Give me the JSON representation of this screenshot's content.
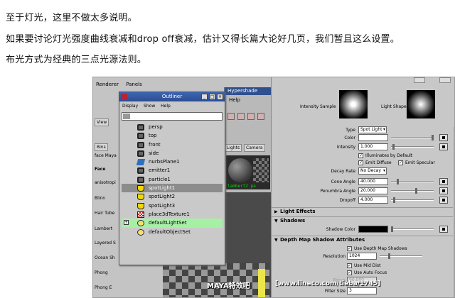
{
  "article": {
    "line1": "至于灯光，这里不做太多说明。",
    "line2": "如果要讨论灯光强度曲线衰减和drop off衰减，估计又得长篇大论好几页，我们暂且这么设置。",
    "line3": "布光方式为经典的三点光源法则。"
  },
  "maya": {
    "menu": [
      "Renderer",
      "Panels"
    ],
    "view_label": "View",
    "bins_label": "Bins",
    "maya_label": "face Maya",
    "left_list": [
      "Face",
      "anisotropi",
      "Blinn",
      "Hair Tube",
      "Lambert",
      "Layered S",
      "Ocean Sh",
      "Phong",
      "Phong E"
    ]
  },
  "hypershade": {
    "title": "Hypershade",
    "help": "Help",
    "tabs": [
      "Lights",
      "Camera"
    ],
    "lambert_label": "lambert2",
    "pa_label": "pa"
  },
  "outliner": {
    "title": "Outliner",
    "menu": [
      "Display",
      "Show",
      "Help"
    ],
    "items": [
      {
        "label": "persp",
        "icon": "camera-icon"
      },
      {
        "label": "top",
        "icon": "camera-icon"
      },
      {
        "label": "front",
        "icon": "camera-icon"
      },
      {
        "label": "side",
        "icon": "camera-icon"
      },
      {
        "label": "nurbsPlane1",
        "icon": "plane-icon"
      },
      {
        "label": "emitter1",
        "icon": "emitter-icon"
      },
      {
        "label": "particle1",
        "icon": "particle-icon"
      },
      {
        "label": "spotLight1",
        "icon": "light-icon",
        "selected": true
      },
      {
        "label": "spotLight2",
        "icon": "light-icon"
      },
      {
        "label": "spotLight3",
        "icon": "light-icon"
      },
      {
        "label": "place3dTexture1",
        "icon": "texture-icon"
      },
      {
        "label": "defaultLightSet",
        "icon": "set-icon",
        "highlighted": true
      },
      {
        "label": "defaultObjectSet",
        "icon": "set-icon"
      }
    ]
  },
  "attr": {
    "intensity_sample": "Intensity Sample",
    "light_shape": "Light Shape",
    "type_label": "Type",
    "type_value": "Spot Light",
    "color_label": "Color",
    "intensity_label": "Intensity",
    "intensity_value": "1.000",
    "illum_default": "Illuminates by Default",
    "emit_diffuse": "Emit Diffuse",
    "emit_specular": "Emit Specular",
    "decay_label": "Decay Rate",
    "decay_value": "No Decay",
    "cone_label": "Cone Angle",
    "cone_value": "40.000",
    "penumbra_label": "Penumbra Angle",
    "penumbra_value": "20.000",
    "dropoff_label": "Dropoff",
    "dropoff_value": "4.000",
    "light_effects": "Light Effects",
    "shadows": "Shadows",
    "shadow_color": "Shadow Color",
    "depth_map": "Depth Map Shadow Attributes",
    "use_depth": "Use Depth Map Shadows",
    "resolution_label": "Resolution",
    "resolution_value": "1024",
    "use_mid": "Use Mid Dist",
    "use_auto": "Use Auto Focus",
    "focus_label": "Focus",
    "focus_value": "90.000",
    "filter_label": "Filter Size",
    "filter_value": "3"
  },
  "watermark": {
    "brand": "MAYA特效吧",
    "url": "[www.lineco.com/tieba/1745]"
  },
  "colors": {
    "titlebar": "#2b4d92",
    "selection": "#8c8c8c",
    "highlight": "#a6f0a6",
    "panel": "#c8c8c8"
  }
}
